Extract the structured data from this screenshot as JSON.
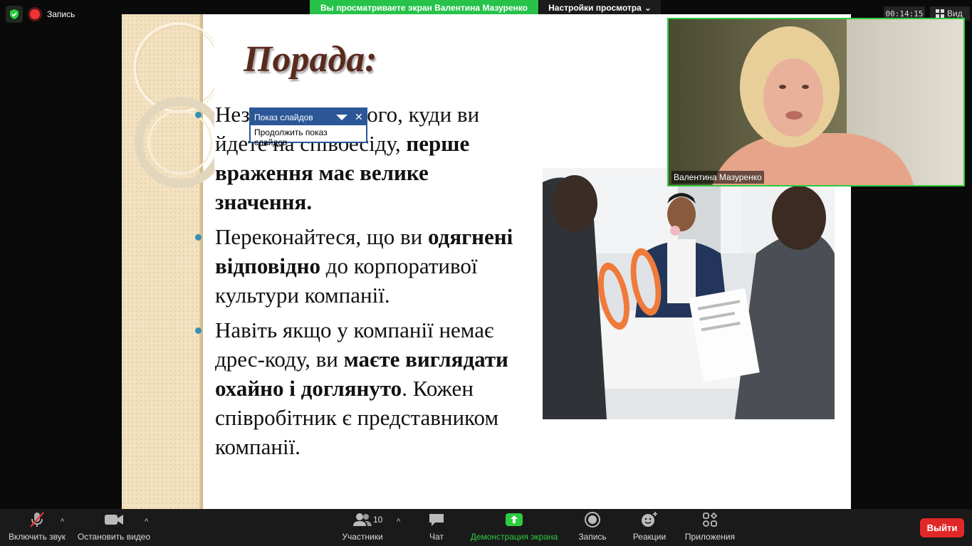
{
  "top": {
    "recording_label": "Запись",
    "banner_text": "Вы просматриваете экран Валентина Мазуренко",
    "view_settings_label": "Настройки просмотра",
    "timer": "00:14:15",
    "view_label": "Вид"
  },
  "slide": {
    "title": "Порада:",
    "bullets": [
      {
        "parts": [
          {
            "t": "Незалежно від того, куди ви йдете на співбесіду, ",
            "b": false
          },
          {
            "t": "перше враження має велике значення.",
            "b": true
          }
        ]
      },
      {
        "parts": [
          {
            "t": "Переконайтеся, що ви ",
            "b": false
          },
          {
            "t": "одягнені відповідно",
            "b": true
          },
          {
            "t": " до корпоративої культури компанії.",
            "b": false
          }
        ]
      },
      {
        "parts": [
          {
            "t": "Навіть якщо у компанії немає дрес-коду, ви ",
            "b": false
          },
          {
            "t": "маєте виглядати охайно і доглянуто",
            "b": true
          },
          {
            "t": ". Кожен співробітник є представником компанії.",
            "b": false
          }
        ]
      }
    ]
  },
  "popup": {
    "title": "Показ слайдов",
    "item": "Продолжить показ слайдов"
  },
  "video": {
    "participant_name": "Валентина Мазуренко"
  },
  "toolbar": {
    "mute_label": "Включить звук",
    "video_label": "Остановить видео",
    "participants_label": "Участники",
    "participants_count": "10",
    "chat_label": "Чат",
    "share_label": "Демонстрация экрана",
    "record_label": "Запись",
    "reactions_label": "Реакции",
    "apps_label": "Приложения",
    "leave_label": "Выйти"
  },
  "colors": {
    "banner": "#26c24a",
    "leave": "#e02828",
    "popup_header": "#2b5797",
    "title": "#5b2a1e",
    "bullet": "#3a8fb0"
  }
}
